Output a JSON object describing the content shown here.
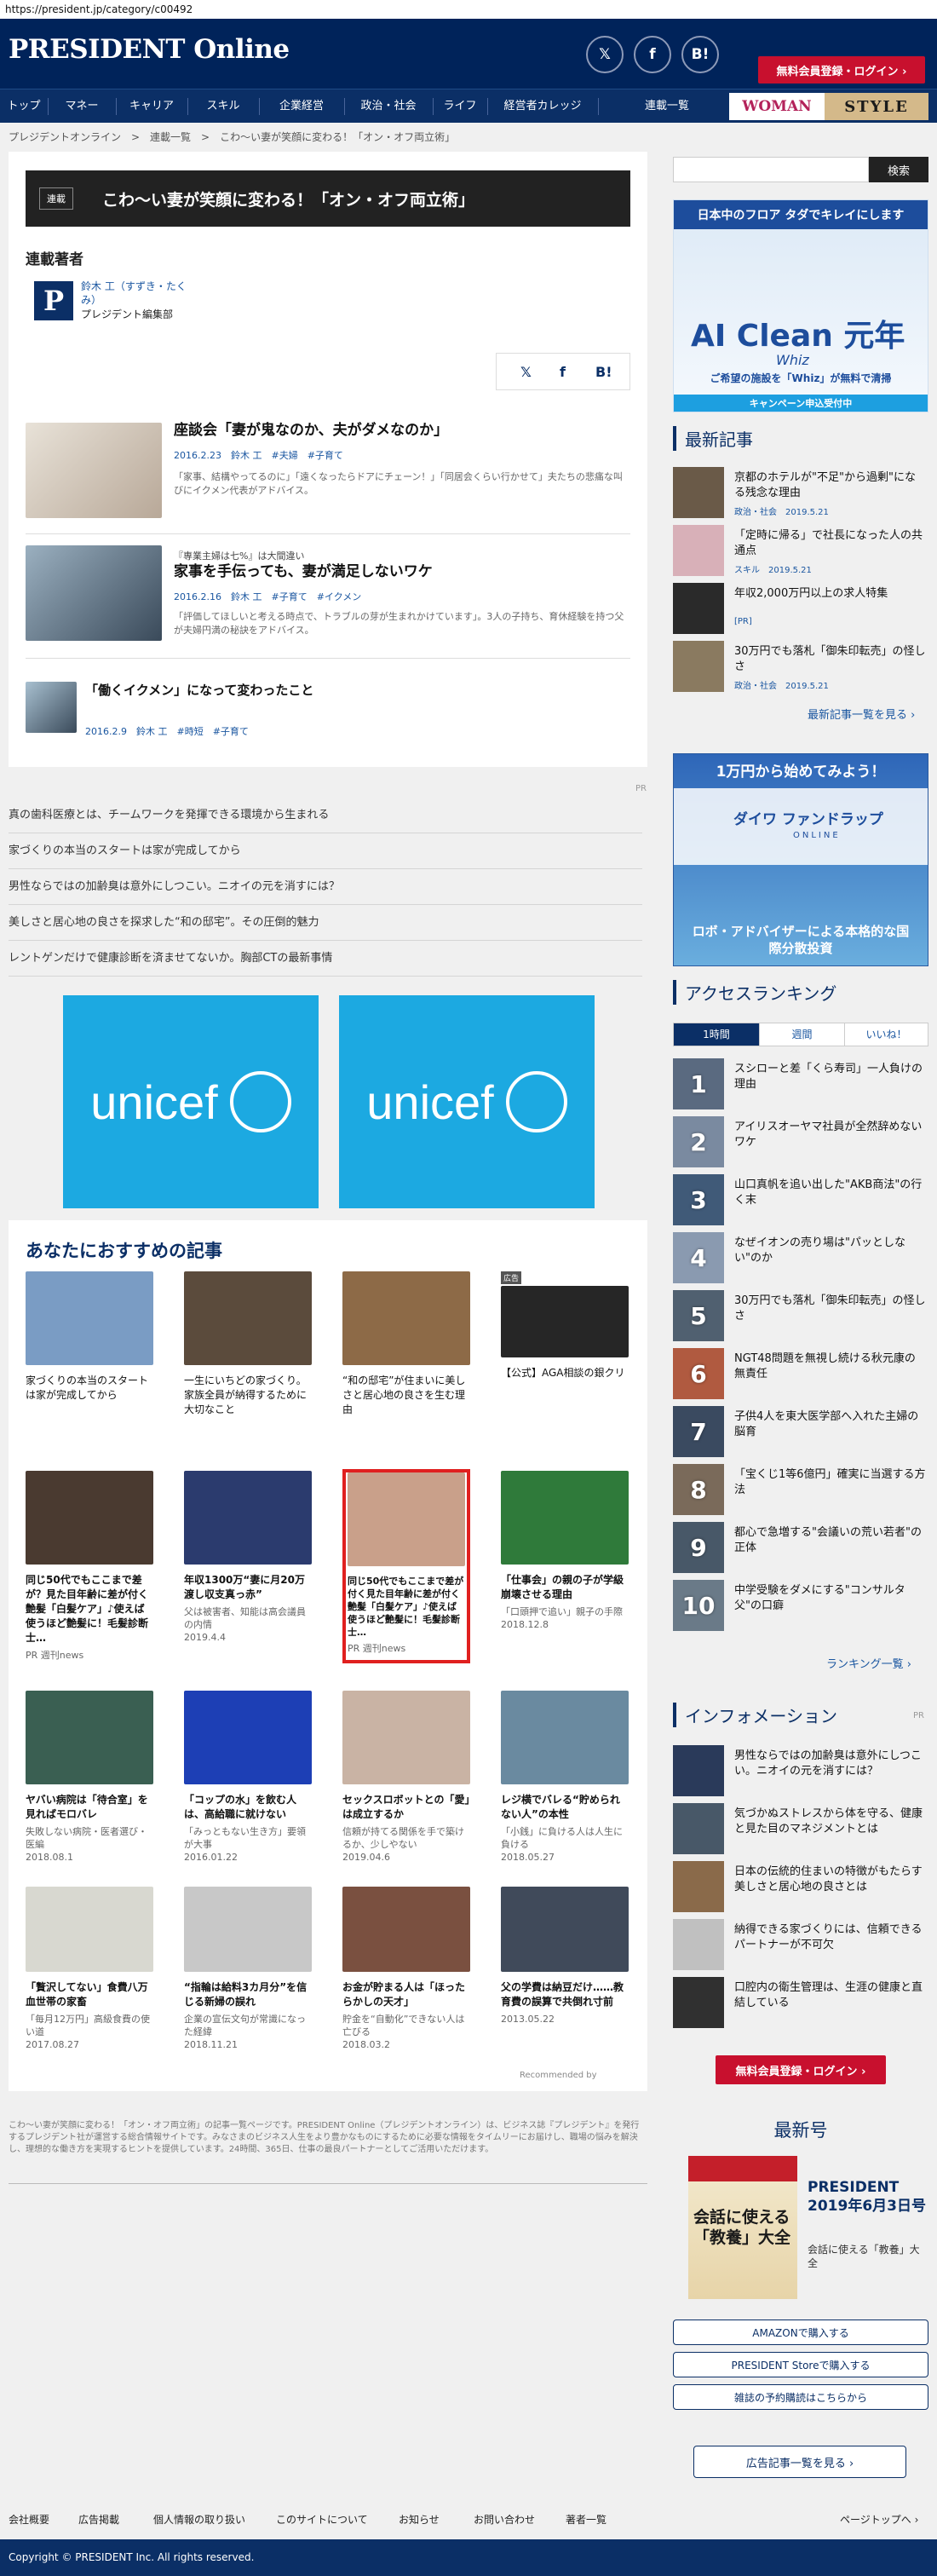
{
  "browser": {
    "url": "https://president.jp/category/c00492"
  },
  "header": {
    "logo": "PRESIDENT Online",
    "social": [
      "twitter-icon",
      "facebook-icon",
      "hatena-icon"
    ],
    "social_labels": [
      "𝕏",
      "f",
      "B!"
    ],
    "login": "無料会員登録・ログイン ›"
  },
  "nav": {
    "items": [
      "トップ",
      "マネー",
      "キャリア",
      "スキル",
      "企業経営",
      "政治・社会",
      "ライフ",
      "経営者カレッジ",
      "連載一覧"
    ],
    "woman": "WOMAN",
    "style": "STYLE"
  },
  "breadcrumb": "プレジデントオンライン　>　連載一覧　>　こわ〜い妻が笑顔に変わる！「オン・オフ両立術」",
  "series": {
    "tag": "連載",
    "title": "こわ〜い妻が笑顔に変わる！「オン・オフ両立術」",
    "author_head": "連載著者",
    "author_logo": "P",
    "author_name": "鈴木 工（すずき・たくみ）",
    "author_role": "プレジデント編集部"
  },
  "share": [
    "twitter-icon",
    "facebook-icon",
    "hatena-icon"
  ],
  "share_labels": [
    "𝕏",
    "f",
    "B!"
  ],
  "articles": [
    {
      "kicker": "",
      "title": "座談会「妻が鬼なのか、夫がダメなのか」",
      "meta": "2016.2.23　鈴木 工　#夫婦　#子育て",
      "desc": "「家事、結構やってるのに」「遠くなったらドアにチェーン！」「同居会くらい行かせて」夫たちの悲痛な叫びにイクメン代表がアドバイス。"
    },
    {
      "kicker": "『専業主婦は七%』は大間違い",
      "title": "家事を手伝っても、妻が満足しないワケ",
      "meta": "2016.2.16　鈴木 工　#子育て　#イクメン",
      "desc": "「評価してほしいと考える時点で、トラブルの芽が生まれかけています」。3人の子持ち、育休経験を持つ父が夫婦円満の秘訣をアドバイス。"
    },
    {
      "kicker": "",
      "title": "「働くイクメン」になって変わったこと",
      "meta": "2016.2.9　鈴木 工　#時短　#子育て",
      "desc": ""
    }
  ],
  "pr_label": "PR",
  "pr_links": [
    "真の歯科医療とは、チームワークを発揮できる環境から生まれる",
    "家づくりの本当のスタートは家が完成してから",
    "男性ならではの加齢臭は意外にしつこい。ニオイの元を消すには？",
    "美しさと居心地の良さを探求した“和の邸宅”。その圧倒的魅力",
    "レントゲンだけで健康診断を済ませてないか。胸部CTの最新事情"
  ],
  "unicef": "unicef",
  "recommend": {
    "head": "あなたにおすすめの記事",
    "ad_label": "広告",
    "items": [
      {
        "title": "家づくりの本当のスタートは家が完成してから",
        "sub": "",
        "color": "#7a9cc4"
      },
      {
        "title": "一生にいちどの家づくり。家族全員が納得するために大切なこと",
        "sub": "",
        "color": "#5b4b3c"
      },
      {
        "title": "“和の邸宅”が住まいに美しさと居心地の良さを生む理由",
        "sub": "",
        "color": "#8d6a47"
      },
      {
        "title": "【公式】AGA相談の銀クリ",
        "sub": "",
        "color": "#262626"
      },
      {
        "title": "同じ50代でもここまで差が？見た目年齢に差が付く艶髪「白髪ケア」♪使えば使うほど艶髪に！毛髪診断士…",
        "sub": "PR 週刊news",
        "color": "#4a3a30"
      },
      {
        "title": "年収1300万“妻に月20万渡し収支真っ赤”",
        "sub": "父は被害者、知能は高会議員の内情\n2019.4.4",
        "color": "#2b3b6e"
      },
      {
        "title": "同じ50代でもここまで差が付く見た目年齢に差が付く艶髪「白髪ケア」♪使えば使うほど艶髪に！毛髪診断士…",
        "sub": "PR 週刊news",
        "color": "#c9a08a"
      },
      {
        "title": "「仕事会」の親の子が学級崩壊させる理由",
        "sub": "「口頭押で追い」親子の手際\n2018.12.8",
        "color": "#2f7a3a"
      },
      {
        "title": "ヤバい病院は「待合室」を見ればモロバレ",
        "sub": "失敗しない病院・医者選び・医編\n2018.08.1",
        "color": "#3a5f52"
      },
      {
        "title": "「コップの水」を飲む人は、高給職に就けない",
        "sub": "「みっともない生き方」要領が大事\n2016.01.22",
        "color": "#1d3fb5"
      },
      {
        "title": "セックスロボットとの「愛」は成立するか",
        "sub": "信頼が持てる関係を手で築けるか、少しやない\n2019.04.6",
        "color": "#c9b3a4"
      },
      {
        "title": "レジ横でバレる“貯められない人”の本性",
        "sub": "「小銭」に負ける人は人生に負ける\n2018.05.27",
        "color": "#6a8aa0"
      },
      {
        "title": "「贅沢してない」食費八万血世帯の家畜",
        "sub": "「毎月12万円」高級食費の使い道\n2017.08.27",
        "color": "#d8d8d0"
      },
      {
        "title": "“指輪は給料3カ月分”を信じる新婦の誤れ",
        "sub": "企業の宣伝文句が常識になった経緯\n2018.11.21",
        "color": "#c8c8c8"
      },
      {
        "title": "お金が貯まる人は「ほったらかしの天才」",
        "sub": "貯金を“自動化”できない人は亡びる\n2018.03.2",
        "color": "#7a5040"
      },
      {
        "title": "父の学費は納豆だけ……教育費の誤算で共倒れ寸前",
        "sub": "2013.05.22",
        "color": "#404a5a"
      }
    ],
    "recommended_by": "Recommended by"
  },
  "footer_desc": "こわ〜い妻が笑顔に変わる！「オン・オフ両立術」の記事一覧ページです。PRESIDENT Online（プレジデントオンライン）は、ビジネス誌『プレジデント』を発行するプレジデント社が運営する総合情報サイトです。みなさまのビジネス人生をより豊かなものにするために必要な情報をタイムリーにお届けし、職場の悩みを解決し、理想的な働き方を実現するヒントを提供しています。24時間、365日、仕事の最良パートナーとしてご活用いただけます。",
  "sidebar": {
    "search_btn": "検索",
    "ad1_title": "日本中のフロア タダでキレイにします",
    "ad1_big": "AI Clean 元年",
    "ad1_brand": "Whiz",
    "ad1_foot": "ご希望の施設を「Whiz」が無料で清掃",
    "ad1_cta": "キャンペーン申込受付中",
    "latest_head": "最新記事",
    "latest": [
      {
        "title": "京都のホテルが\"不足\"から過剰\"になる残念な理由",
        "meta": "政治・社会　2019.5.21"
      },
      {
        "title": "「定時に帰る」で社長になった人の共通点",
        "meta": "スキル　2019.5.21"
      },
      {
        "title": "年収2,000万円以上の求人特集",
        "meta": "[PR]"
      },
      {
        "title": "30万円でも落札「御朱印転売」の怪しさ",
        "meta": "政治・社会　2019.5.21"
      }
    ],
    "latest_more": "最新記事一覧を見る ›",
    "ad2_top": "1万円から始めてみよう！",
    "ad2_brand": "ダイワ ファンドラップ",
    "ad2_sub": "ONLINE",
    "ad2_foot": "ロボ・アドバイザーによる本格的な国際分散投資",
    "ranking_head": "アクセスランキング",
    "rank_tabs": [
      "1時間",
      "週間",
      "いいね！"
    ],
    "ranking": [
      "スシローと差「くら寿司」一人負けの理由",
      "アイリスオーヤマ社員が全然辞めないワケ",
      "山口真帆を追い出した\"AKB商法\"の行く末",
      "なぜイオンの売り場は\"パッとしない\"のか",
      "30万円でも落札「御朱印転売」の怪しさ",
      "NGT48問題を無視し続ける秋元康の無責任",
      "子供4人を東大医学部へ入れた主婦の脳育",
      "「宝くじ1等6億円」確実に当選する方法",
      "都心で急増する\"会議いの荒い若者\"の正体",
      "中学受験をダメにする\"コンサルタ父\"の口癖"
    ],
    "ranking_more": "ランキング一覧 ›",
    "info_head": "インフォメーション",
    "info_pr": "PR",
    "info": [
      "男性ならではの加齢臭は意外にしつこい。ニオイの元を消すには？",
      "気づかぬストレスから体を守る、健康と見た目のマネジメントとは",
      "日本の伝統的住まいの特徴がもたらす美しさと居心地の良さとは",
      "納得できる家づくりには、信頼できるパートナーが不可欠",
      "口腔内の衛生管理は、生涯の健康と直結している"
    ],
    "login": "無料会員登録・ログイン ›",
    "issue_head": "最新号",
    "issue_title": "PRESIDENT 2019年6月3日号",
    "issue_sub": "会話に使える「教養」大全",
    "issue_cover": "会話に使える「教養」大全",
    "buy": [
      "AMAZONで購入する",
      "PRESIDENT Storeで購入する",
      "雑誌の予約購読はこちらから"
    ],
    "ad_more": "広告記事一覧を見る ›"
  },
  "footer": {
    "links": [
      "会社概要",
      "広告掲載",
      "個人情報の取り扱い",
      "このサイトについて",
      "お知らせ",
      "お問い合わせ",
      "著者一覧"
    ],
    "top": "ページトップへ ›",
    "copyright": "Copyright © PRESIDENT Inc. All rights reserved."
  }
}
